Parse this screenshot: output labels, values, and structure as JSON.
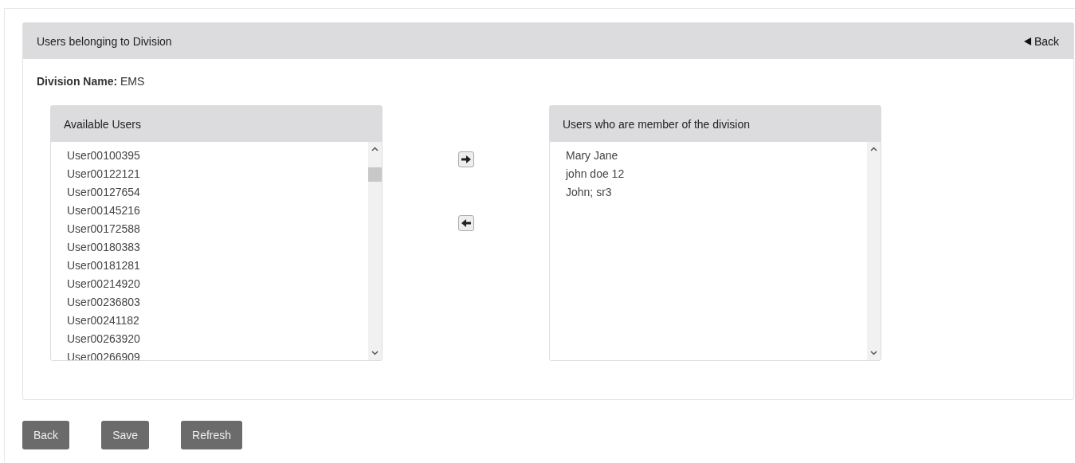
{
  "panel": {
    "title": "Users belonging to Division",
    "back_link": "Back"
  },
  "division": {
    "label": "Division Name:",
    "value": "EMS"
  },
  "available": {
    "title": "Available Users",
    "items": [
      "User00100395",
      "User00122121",
      "User00127654",
      "User00145216",
      "User00172588",
      "User00180383",
      "User00181281",
      "User00214920",
      "User00236803",
      "User00241182",
      "User00263920",
      "User00266909"
    ]
  },
  "members": {
    "title": "Users who are member of the division",
    "items": [
      "Mary Jane",
      "john doe 12",
      "John; sr3"
    ]
  },
  "buttons": [
    "Back",
    "Save",
    "Refresh"
  ]
}
